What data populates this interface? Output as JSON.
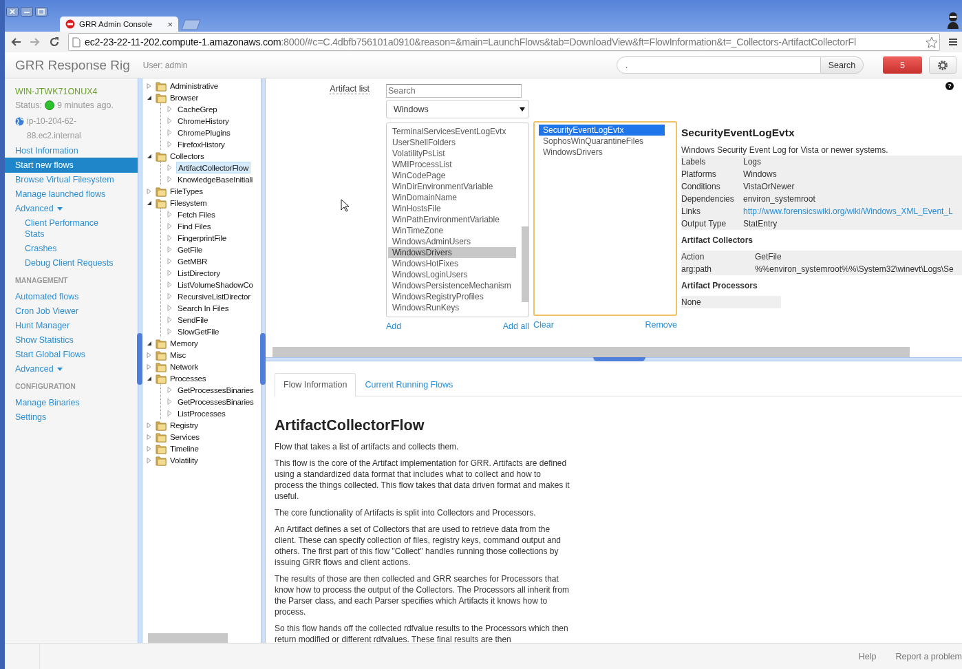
{
  "browser": {
    "tab": {
      "title": "GRR Admin Console",
      "close": "×"
    },
    "url": {
      "host": "ec2-23-22-11-202.compute-1.amazonaws.com",
      "path": ":8000/#c=C.4dbfb756101a0910&reason=&main=LaunchFlows&tab=DownloadView&ft=FlowInformation&t=_Collectors-ArtifactCollectorFl"
    }
  },
  "header": {
    "brand": "GRR Response Rig",
    "user": "User: admin",
    "search": {
      "value": "."
    },
    "search_button": "Search",
    "notifications": "5"
  },
  "sidebar": {
    "client": {
      "name": "WIN-JTWK71ONUX4",
      "status_label": "Status:",
      "online": true,
      "last_seen": "9 minutes ago.",
      "hostname": "ip-10-204-62-88.ec2.internal"
    },
    "items": [
      {
        "kind": "link",
        "label": "Host Information",
        "selected": false
      },
      {
        "kind": "link",
        "label": "Start new flows",
        "selected": true
      },
      {
        "kind": "link",
        "label": "Browse Virtual Filesystem",
        "selected": false
      },
      {
        "kind": "link",
        "label": "Manage launched flows",
        "selected": false
      },
      {
        "kind": "dropdown",
        "label": "Advanced",
        "selected": false
      },
      {
        "kind": "sublink",
        "label": "Client Performance Stats",
        "selected": false
      },
      {
        "kind": "sublink",
        "label": "Crashes",
        "selected": false
      },
      {
        "kind": "sublink",
        "label": "Debug Client Requests",
        "selected": false
      },
      {
        "kind": "heading",
        "label": "MANAGEMENT",
        "selected": false
      },
      {
        "kind": "link",
        "label": "Automated flows",
        "selected": false
      },
      {
        "kind": "link",
        "label": "Cron Job Viewer",
        "selected": false
      },
      {
        "kind": "link",
        "label": "Hunt Manager",
        "selected": false
      },
      {
        "kind": "link",
        "label": "Show Statistics",
        "selected": false
      },
      {
        "kind": "link",
        "label": "Start Global Flows",
        "selected": false
      },
      {
        "kind": "dropdown",
        "label": "Advanced",
        "selected": false
      },
      {
        "kind": "heading",
        "label": "CONFIGURATION",
        "selected": false
      },
      {
        "kind": "link",
        "label": "Manage Binaries",
        "selected": false
      },
      {
        "kind": "link",
        "label": "Settings",
        "selected": false
      }
    ]
  },
  "tree": [
    {
      "label": "Administrative",
      "expanded": false,
      "selected": false
    },
    {
      "label": "Browser",
      "expanded": true,
      "selected": false,
      "children": [
        {
          "label": "CacheGrep",
          "selected": false
        },
        {
          "label": "ChromeHistory",
          "selected": false
        },
        {
          "label": "ChromePlugins",
          "selected": false
        },
        {
          "label": "FirefoxHistory",
          "selected": false
        }
      ]
    },
    {
      "label": "Collectors",
      "expanded": true,
      "selected": false,
      "children": [
        {
          "label": "ArtifactCollectorFlow",
          "selected": true
        },
        {
          "label": "KnowledgeBaseInitiali",
          "selected": false
        }
      ]
    },
    {
      "label": "FileTypes",
      "expanded": false,
      "selected": false
    },
    {
      "label": "Filesystem",
      "expanded": true,
      "selected": false,
      "children": [
        {
          "label": "Fetch Files",
          "selected": false
        },
        {
          "label": "Find Files",
          "selected": false
        },
        {
          "label": "FingerprintFile",
          "selected": false
        },
        {
          "label": "GetFile",
          "selected": false
        },
        {
          "label": "GetMBR",
          "selected": false
        },
        {
          "label": "ListDirectory",
          "selected": false
        },
        {
          "label": "ListVolumeShadowCo",
          "selected": false
        },
        {
          "label": "RecursiveListDirector",
          "selected": false
        },
        {
          "label": "Search In Files",
          "selected": false
        },
        {
          "label": "SendFile",
          "selected": false
        },
        {
          "label": "SlowGetFile",
          "selected": false
        }
      ]
    },
    {
      "label": "Memory",
      "expanded": true,
      "selected": false
    },
    {
      "label": "Misc",
      "expanded": false,
      "selected": false
    },
    {
      "label": "Network",
      "expanded": false,
      "selected": false
    },
    {
      "label": "Processes",
      "expanded": true,
      "selected": false,
      "children": [
        {
          "label": "GetProcessesBinaries",
          "selected": false
        },
        {
          "label": "GetProcessesBinaries",
          "selected": false
        },
        {
          "label": "ListProcesses",
          "selected": false
        }
      ]
    },
    {
      "label": "Registry",
      "expanded": false,
      "selected": false
    },
    {
      "label": "Services",
      "expanded": false,
      "selected": false
    },
    {
      "label": "Timeline",
      "expanded": false,
      "selected": false
    },
    {
      "label": "Volatility",
      "expanded": false,
      "selected": false
    }
  ],
  "artifacts": {
    "label": "Artifact list",
    "help": "?",
    "search": {
      "placeholder": "Search"
    },
    "platform": "Windows",
    "available": [
      {
        "label": "TerminalServicesEventLogEvtx",
        "selected": false
      },
      {
        "label": "UserShellFolders",
        "selected": false
      },
      {
        "label": "VolatilityPsList",
        "selected": false
      },
      {
        "label": "WMIProcessList",
        "selected": false
      },
      {
        "label": "WinCodePage",
        "selected": false
      },
      {
        "label": "WinDirEnvironmentVariable",
        "selected": false
      },
      {
        "label": "WinDomainName",
        "selected": false
      },
      {
        "label": "WinHostsFile",
        "selected": false
      },
      {
        "label": "WinPathEnvironmentVariable",
        "selected": false
      },
      {
        "label": "WinTimeZone",
        "selected": false
      },
      {
        "label": "WindowsAdminUsers",
        "selected": false
      },
      {
        "label": "WindowsDrivers",
        "selected": true
      },
      {
        "label": "WindowsHotFixes",
        "selected": false
      },
      {
        "label": "WindowsLoginUsers",
        "selected": false
      },
      {
        "label": "WindowsPersistenceMechanism",
        "selected": false
      },
      {
        "label": "WindowsRegistryProfiles",
        "selected": false
      },
      {
        "label": "WindowsRunKeys",
        "selected": false
      }
    ],
    "available_actions": [
      "Add",
      "Add all"
    ],
    "chosen": [
      {
        "label": "SecurityEventLogEvtx",
        "selected": true
      },
      {
        "label": "SophosWinQuarantineFiles",
        "selected": false
      },
      {
        "label": "WindowsDrivers",
        "selected": false
      }
    ],
    "chosen_actions": [
      "Clear",
      "Remove"
    ],
    "details": {
      "title": "SecurityEventLogEvtx",
      "description": "Windows Security Event Log for Vista or newer systems.",
      "properties": [
        {
          "label": "Labels",
          "value": "Logs",
          "kind": "text"
        },
        {
          "label": "Platforms",
          "value": "Windows",
          "kind": "text"
        },
        {
          "label": "Conditions",
          "value": "VistaOrNewer",
          "kind": "text"
        },
        {
          "label": "Dependencies",
          "value": "environ_systemroot",
          "kind": "text"
        },
        {
          "label": "Links",
          "value": "http://www.forensicswiki.org/wiki/Windows_XML_Event_L",
          "kind": "link"
        },
        {
          "label": "Output Type",
          "value": "StatEntry",
          "kind": "text"
        }
      ],
      "collectors_heading": "Artifact Collectors",
      "collectors": [
        {
          "label": "Action",
          "value": "GetFile"
        },
        {
          "label": "arg:path",
          "value": "%%environ_systemroot%%\\System32\\winevt\\Logs\\Se"
        }
      ],
      "processors_heading": "Artifact Processors",
      "processors": [
        "None"
      ]
    }
  },
  "flow": {
    "tabs": [
      {
        "label": "Flow Information",
        "selected": true
      },
      {
        "label": "Current Running Flows",
        "selected": false
      }
    ],
    "title": "ArtifactCollectorFlow",
    "paragraphs": [
      "Flow that takes a list of artifacts and collects them.",
      "This flow is the core of the Artifact implementation for GRR. Artifacts are defined using a standardized data format that includes what to collect and how to process the things collected. This flow takes that data driven format and makes it useful.",
      "The core functionality of Artifacts is split into Collectors and Processors.",
      "An Artifact defines a set of Collectors that are used to retrieve data from the client. These can specify collection of files, registry keys, command output and others. The first part of this flow \"Collect\" handles running those collections by issuing GRR flows and client actions.",
      "The results of those are then collected and GRR searches for Processors that know how to process the output of the Collectors. The Processors all inherit from the Parser class, and each Parser specifies which Artifacts it knows how to process.",
      "So this flow hands off the collected rdfvalue results to the Processors which then return modified or different rdfvalues. These final results are then"
    ]
  },
  "footer": {
    "links": [
      "Help",
      "Report a problem"
    ]
  }
}
